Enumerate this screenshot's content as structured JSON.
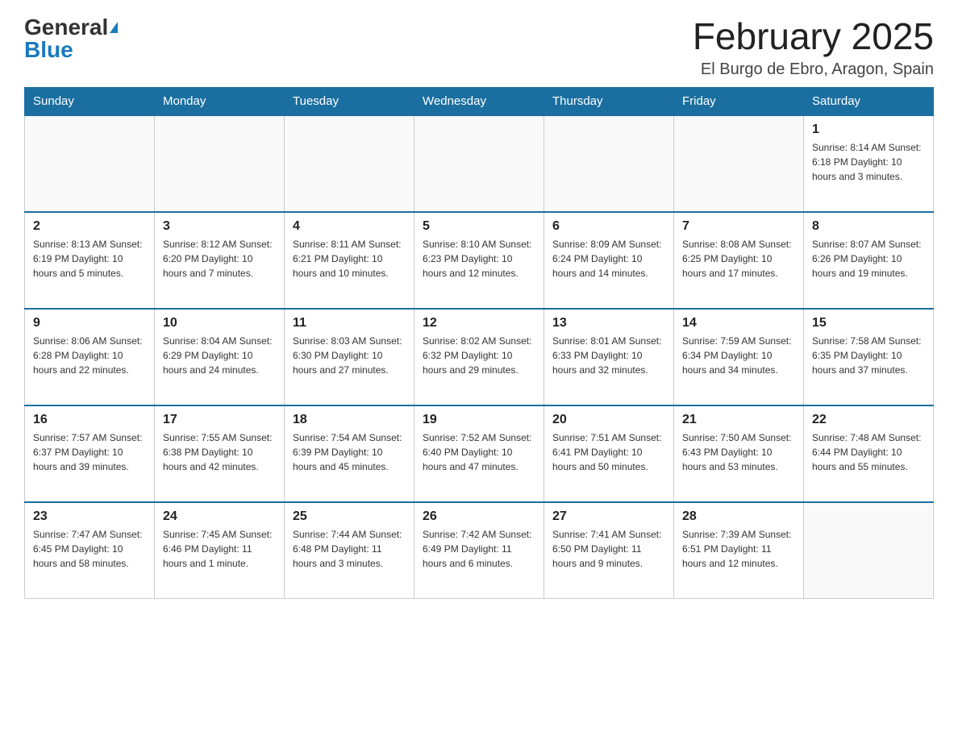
{
  "logo": {
    "general": "General",
    "blue": "Blue"
  },
  "title": "February 2025",
  "subtitle": "El Burgo de Ebro, Aragon, Spain",
  "days_of_week": [
    "Sunday",
    "Monday",
    "Tuesday",
    "Wednesday",
    "Thursday",
    "Friday",
    "Saturday"
  ],
  "weeks": [
    {
      "days": [
        {
          "num": "",
          "info": ""
        },
        {
          "num": "",
          "info": ""
        },
        {
          "num": "",
          "info": ""
        },
        {
          "num": "",
          "info": ""
        },
        {
          "num": "",
          "info": ""
        },
        {
          "num": "",
          "info": ""
        },
        {
          "num": "1",
          "info": "Sunrise: 8:14 AM\nSunset: 6:18 PM\nDaylight: 10 hours and 3 minutes."
        }
      ]
    },
    {
      "days": [
        {
          "num": "2",
          "info": "Sunrise: 8:13 AM\nSunset: 6:19 PM\nDaylight: 10 hours and 5 minutes."
        },
        {
          "num": "3",
          "info": "Sunrise: 8:12 AM\nSunset: 6:20 PM\nDaylight: 10 hours and 7 minutes."
        },
        {
          "num": "4",
          "info": "Sunrise: 8:11 AM\nSunset: 6:21 PM\nDaylight: 10 hours and 10 minutes."
        },
        {
          "num": "5",
          "info": "Sunrise: 8:10 AM\nSunset: 6:23 PM\nDaylight: 10 hours and 12 minutes."
        },
        {
          "num": "6",
          "info": "Sunrise: 8:09 AM\nSunset: 6:24 PM\nDaylight: 10 hours and 14 minutes."
        },
        {
          "num": "7",
          "info": "Sunrise: 8:08 AM\nSunset: 6:25 PM\nDaylight: 10 hours and 17 minutes."
        },
        {
          "num": "8",
          "info": "Sunrise: 8:07 AM\nSunset: 6:26 PM\nDaylight: 10 hours and 19 minutes."
        }
      ]
    },
    {
      "days": [
        {
          "num": "9",
          "info": "Sunrise: 8:06 AM\nSunset: 6:28 PM\nDaylight: 10 hours and 22 minutes."
        },
        {
          "num": "10",
          "info": "Sunrise: 8:04 AM\nSunset: 6:29 PM\nDaylight: 10 hours and 24 minutes."
        },
        {
          "num": "11",
          "info": "Sunrise: 8:03 AM\nSunset: 6:30 PM\nDaylight: 10 hours and 27 minutes."
        },
        {
          "num": "12",
          "info": "Sunrise: 8:02 AM\nSunset: 6:32 PM\nDaylight: 10 hours and 29 minutes."
        },
        {
          "num": "13",
          "info": "Sunrise: 8:01 AM\nSunset: 6:33 PM\nDaylight: 10 hours and 32 minutes."
        },
        {
          "num": "14",
          "info": "Sunrise: 7:59 AM\nSunset: 6:34 PM\nDaylight: 10 hours and 34 minutes."
        },
        {
          "num": "15",
          "info": "Sunrise: 7:58 AM\nSunset: 6:35 PM\nDaylight: 10 hours and 37 minutes."
        }
      ]
    },
    {
      "days": [
        {
          "num": "16",
          "info": "Sunrise: 7:57 AM\nSunset: 6:37 PM\nDaylight: 10 hours and 39 minutes."
        },
        {
          "num": "17",
          "info": "Sunrise: 7:55 AM\nSunset: 6:38 PM\nDaylight: 10 hours and 42 minutes."
        },
        {
          "num": "18",
          "info": "Sunrise: 7:54 AM\nSunset: 6:39 PM\nDaylight: 10 hours and 45 minutes."
        },
        {
          "num": "19",
          "info": "Sunrise: 7:52 AM\nSunset: 6:40 PM\nDaylight: 10 hours and 47 minutes."
        },
        {
          "num": "20",
          "info": "Sunrise: 7:51 AM\nSunset: 6:41 PM\nDaylight: 10 hours and 50 minutes."
        },
        {
          "num": "21",
          "info": "Sunrise: 7:50 AM\nSunset: 6:43 PM\nDaylight: 10 hours and 53 minutes."
        },
        {
          "num": "22",
          "info": "Sunrise: 7:48 AM\nSunset: 6:44 PM\nDaylight: 10 hours and 55 minutes."
        }
      ]
    },
    {
      "days": [
        {
          "num": "23",
          "info": "Sunrise: 7:47 AM\nSunset: 6:45 PM\nDaylight: 10 hours and 58 minutes."
        },
        {
          "num": "24",
          "info": "Sunrise: 7:45 AM\nSunset: 6:46 PM\nDaylight: 11 hours and 1 minute."
        },
        {
          "num": "25",
          "info": "Sunrise: 7:44 AM\nSunset: 6:48 PM\nDaylight: 11 hours and 3 minutes."
        },
        {
          "num": "26",
          "info": "Sunrise: 7:42 AM\nSunset: 6:49 PM\nDaylight: 11 hours and 6 minutes."
        },
        {
          "num": "27",
          "info": "Sunrise: 7:41 AM\nSunset: 6:50 PM\nDaylight: 11 hours and 9 minutes."
        },
        {
          "num": "28",
          "info": "Sunrise: 7:39 AM\nSunset: 6:51 PM\nDaylight: 11 hours and 12 minutes."
        },
        {
          "num": "",
          "info": ""
        }
      ]
    }
  ]
}
